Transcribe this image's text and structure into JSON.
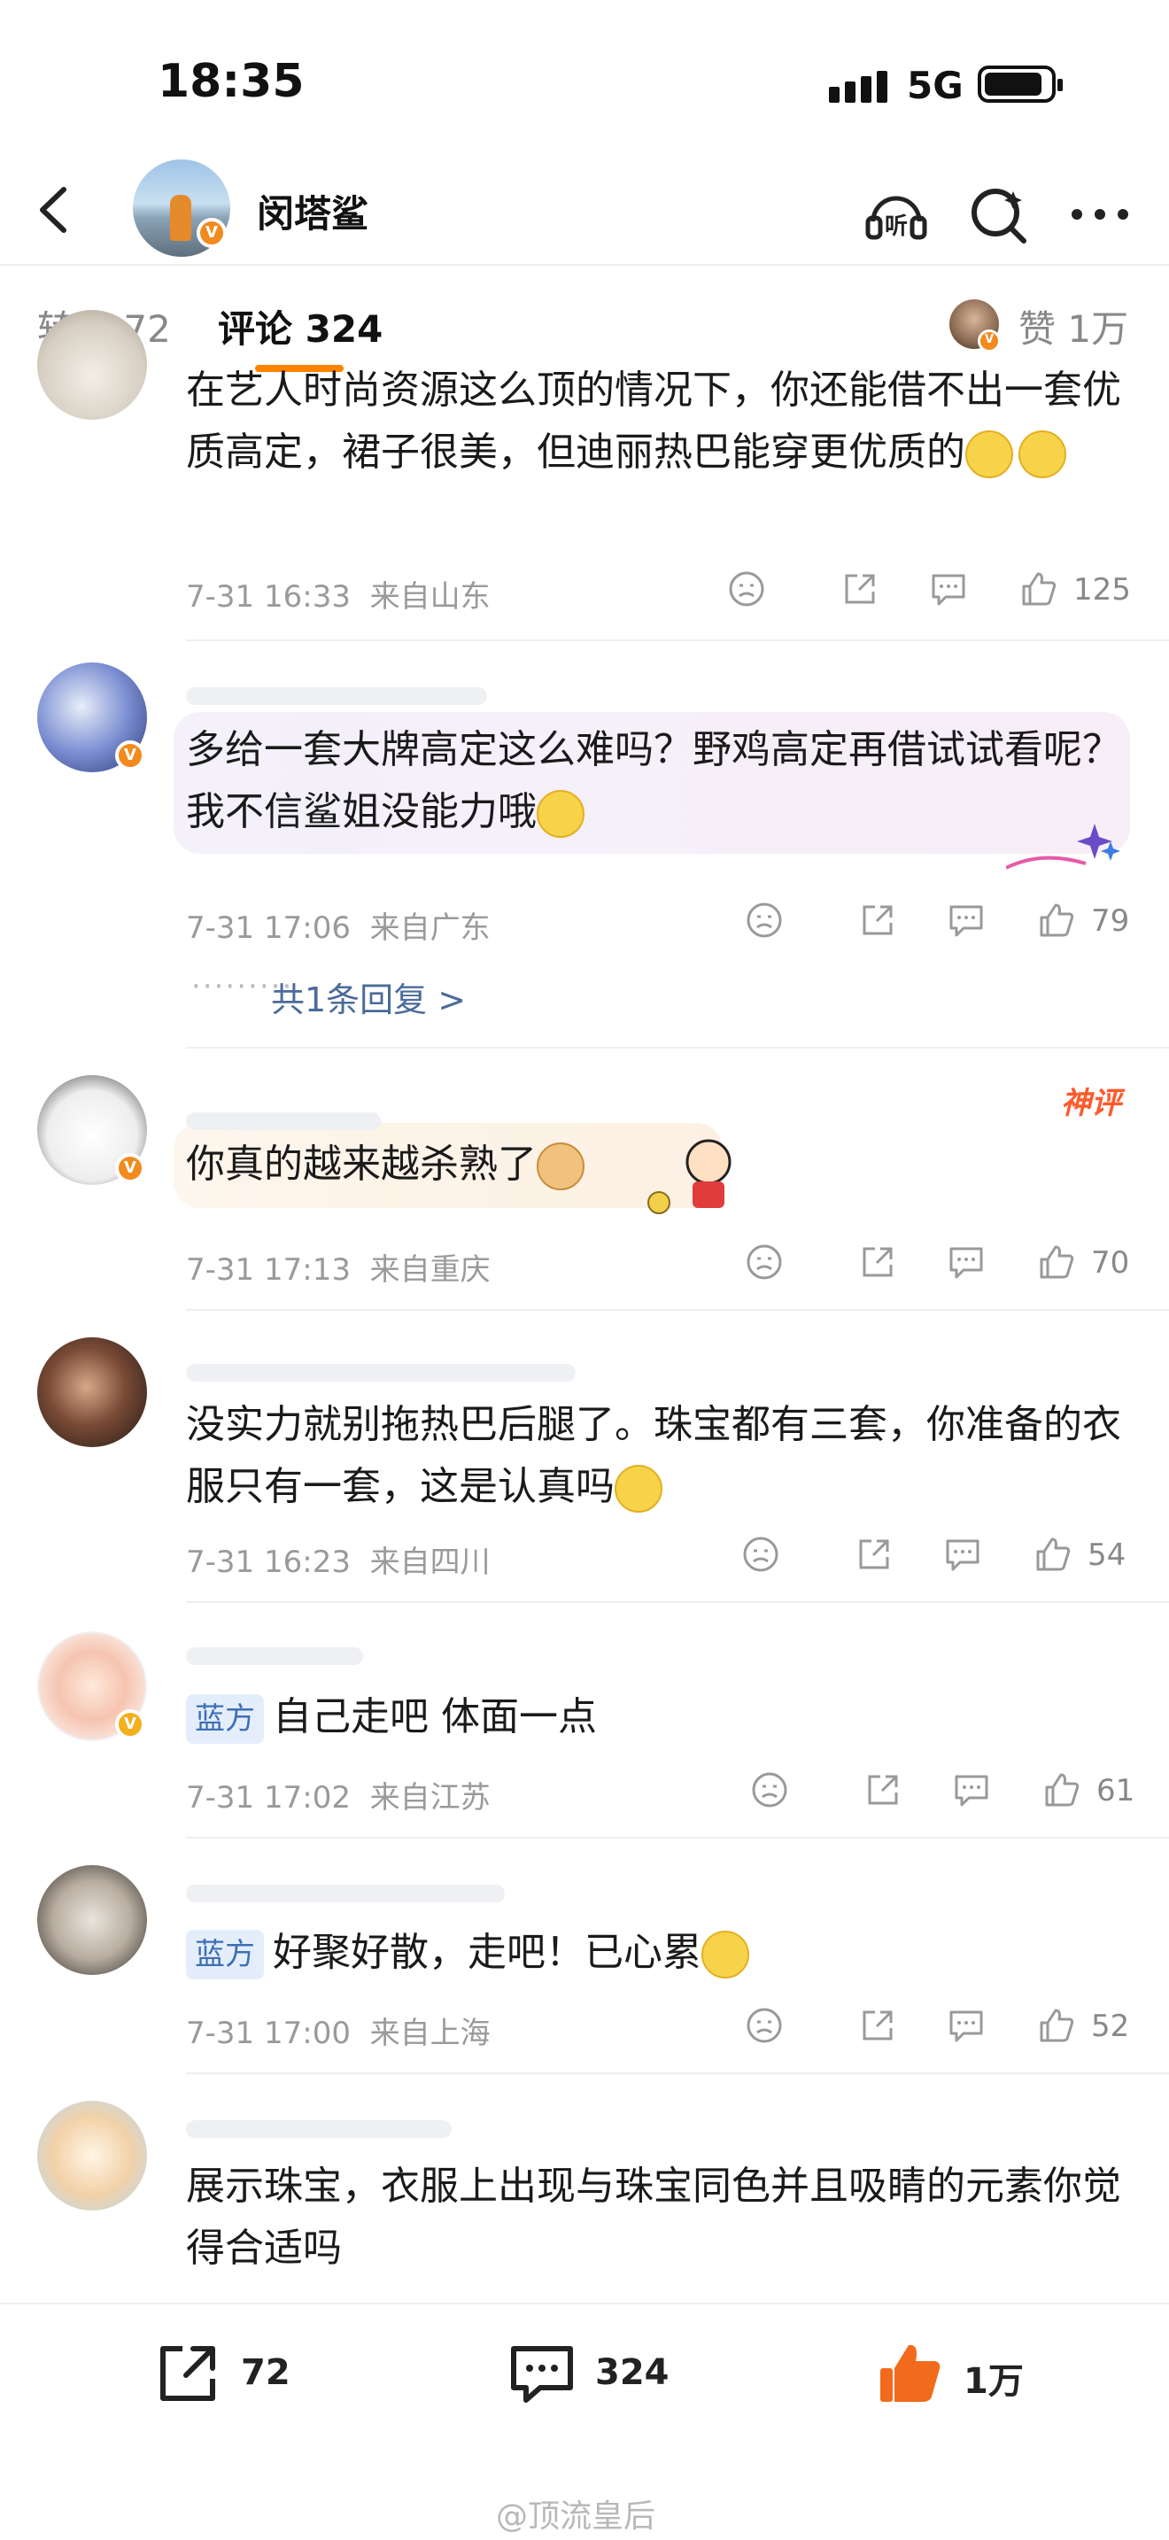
{
  "status": {
    "time": "18:35",
    "network": "5G"
  },
  "nav": {
    "title": "闵塔鲨",
    "verified_badge": "V"
  },
  "tabs": {
    "repost": "转发 72",
    "comment": "评论 324",
    "like": "赞 1万"
  },
  "comments": [
    {
      "text": "在艺人时尚资源这么顶的情况下，你还能借不出一套优质高定，裙子很美，但迪丽热巴能穿更优质的",
      "time": "7-31 16:33",
      "location": "来自山东",
      "likes": "125"
    },
    {
      "text": "多给一套大牌高定这么难吗？野鸡高定再借试试看呢？我不信鲨姐没能力哦",
      "time": "7-31 17:06",
      "location": "来自广东",
      "likes": "79",
      "replies": "共1条回复 >"
    },
    {
      "text": "你真的越来越杀熟了",
      "time": "7-31 17:13",
      "location": "来自重庆",
      "likes": "70",
      "badge": "神评"
    },
    {
      "text": "没实力就别拖热巴后腿了。珠宝都有三套，你准备的衣服只有一套，这是认真吗",
      "time": "7-31 16:23",
      "location": "来自四川",
      "likes": "54"
    },
    {
      "tag": "蓝方",
      "text": "自己走吧 体面一点",
      "time": "7-31 17:02",
      "location": "来自江苏",
      "likes": "61"
    },
    {
      "tag": "蓝方",
      "text": "好聚好散，走吧！已心累",
      "time": "7-31 17:00",
      "location": "来自上海",
      "likes": "52"
    },
    {
      "text": "展示珠宝，衣服上出现与珠宝同色并且吸睛的元素你觉得合适吗"
    }
  ],
  "bottom": {
    "repost_count": "72",
    "comment_count": "324",
    "like_count": "1万",
    "watermark": "@顶流皇后"
  },
  "colors": {
    "accent": "#ff8200",
    "link": "#4a6b9a",
    "tag_bg": "#e4eefb",
    "like_active": "#f26a1b"
  }
}
